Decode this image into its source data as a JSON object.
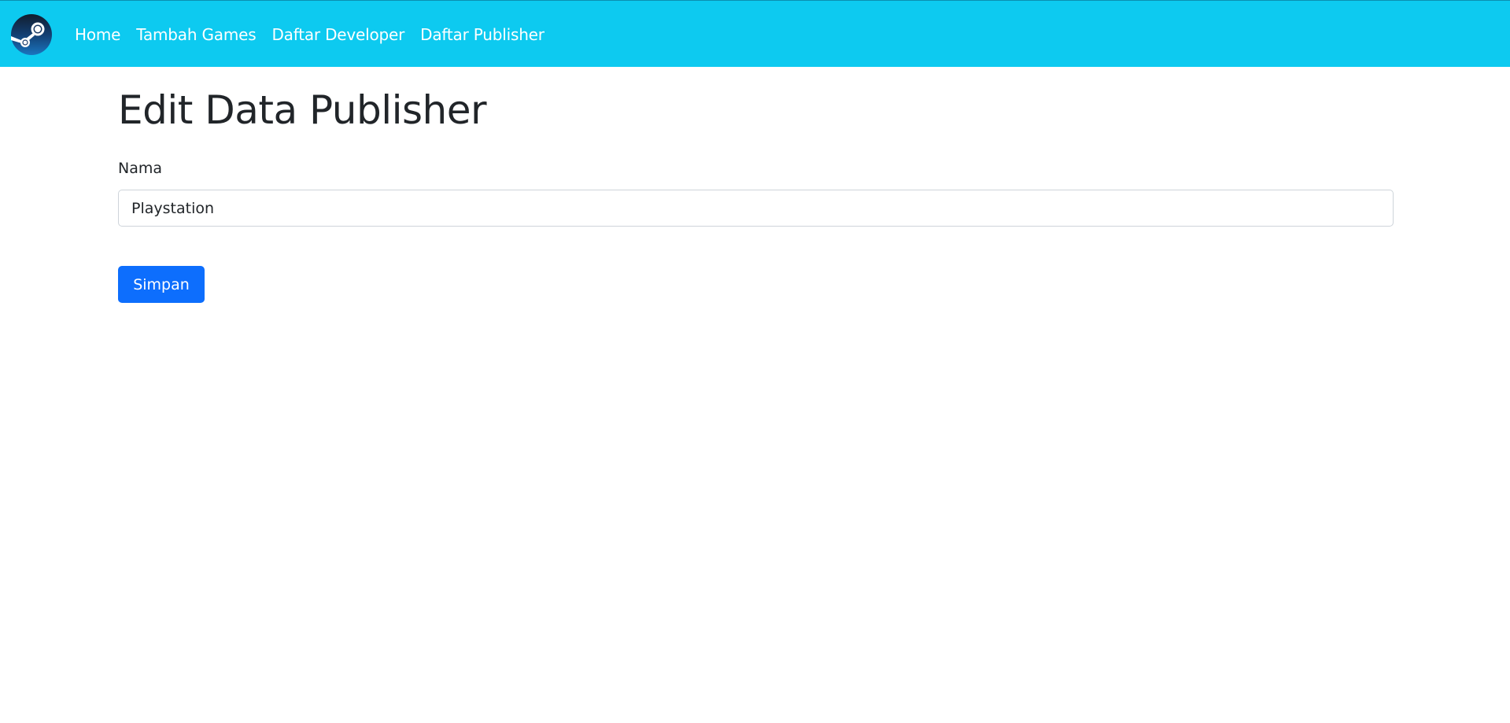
{
  "navbar": {
    "logo_icon": "steam-logo-icon",
    "background_color": "#0dcaf0",
    "links": [
      {
        "label": "Home"
      },
      {
        "label": "Tambah Games"
      },
      {
        "label": "Daftar Developer"
      },
      {
        "label": "Daftar Publisher"
      }
    ]
  },
  "main": {
    "title": "Edit Data Publisher",
    "form": {
      "name_label": "Nama",
      "name_value": "Playstation",
      "submit_label": "Simpan",
      "submit_color": "#0d6efd"
    }
  }
}
